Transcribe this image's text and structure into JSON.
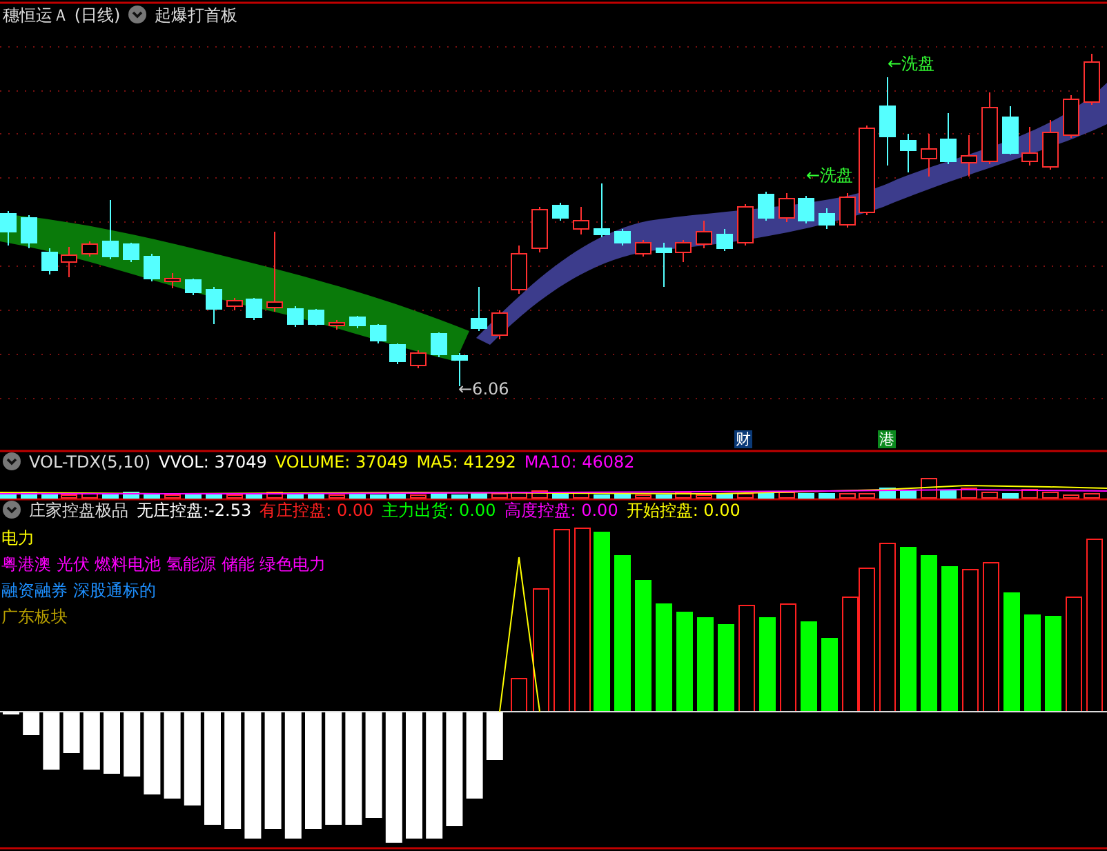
{
  "main_chart": {
    "title": "穗恒运Ａ (日线)",
    "indicator": "起爆打首板",
    "annotations": [
      {
        "kind": "signal",
        "text": "←洗盘"
      },
      {
        "kind": "signal",
        "text": "←洗盘"
      },
      {
        "kind": "low",
        "text": "←6.06"
      }
    ],
    "markers": [
      {
        "text": "财",
        "color": "#0b3a78"
      },
      {
        "text": "港",
        "color": "#0c8a1e"
      }
    ]
  },
  "volume_panel": {
    "name": "VOL-TDX(5,10)",
    "readings": [
      {
        "text": "VVOL: 37049",
        "color": "#ffffff"
      },
      {
        "text": "VOLUME: 37049",
        "color": "#ffff00"
      },
      {
        "text": "MA5: 41292",
        "color": "#ffff00"
      },
      {
        "text": "MA10: 46082",
        "color": "#ff00ff"
      }
    ]
  },
  "indicator_panel": {
    "name": "庄家控盘极品",
    "readings": [
      {
        "text": "无庄控盘:-2.53",
        "color": "#ffffff"
      },
      {
        "text": "有庄控盘: 0.00",
        "color": "#ff2020"
      },
      {
        "text": "主力出货: 0.00",
        "color": "#00ff00"
      },
      {
        "text": "高度控盘: 0.00",
        "color": "#ff00ff"
      },
      {
        "text": "开始控盘: 0.00",
        "color": "#ffff00"
      }
    ],
    "tags": [
      {
        "text": "电力",
        "color": "#ffff00"
      },
      {
        "text": "粤港澳 光伏 燃料电池 氢能源 储能 绿色电力",
        "color": "#ff00ff"
      },
      {
        "text": "融资融券 深股通标的",
        "color": "#1e90ff"
      },
      {
        "text": "广东板块",
        "color": "#b8a000"
      }
    ]
  }
}
